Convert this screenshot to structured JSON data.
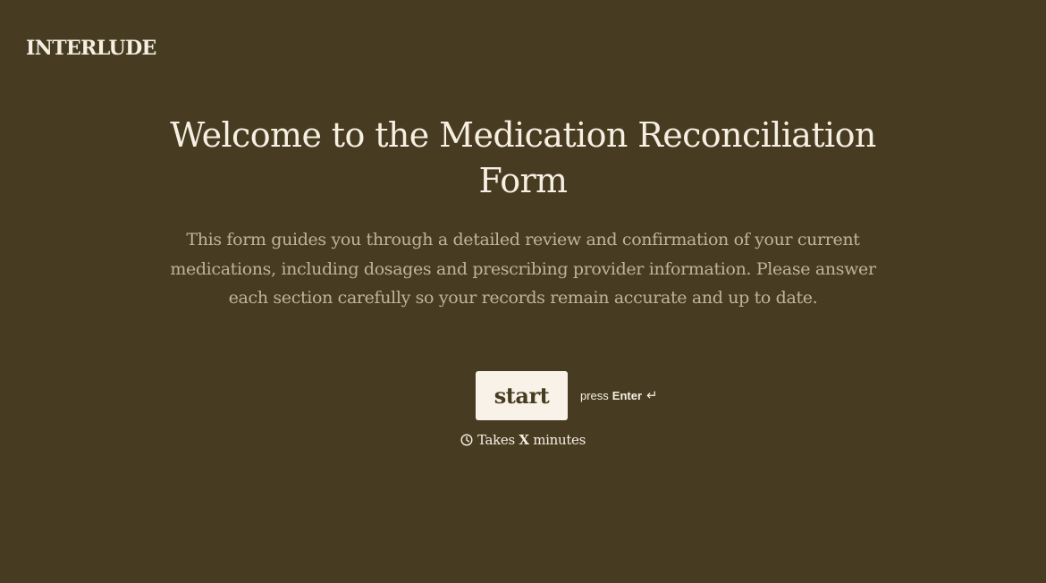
{
  "brand": {
    "logo_text": "INTERLUDE"
  },
  "welcome": {
    "title": "Welcome to the Medication Reconciliation Form",
    "description": "This form guides you through a detailed review and confirmation of your current medications, including dosages and prescribing provider information. Please answer each section carefully so your records remain accurate and up to date."
  },
  "actions": {
    "start_label": "start",
    "hint_prefix": "press",
    "hint_key": "Enter",
    "hint_icon": "↵"
  },
  "duration": {
    "icon": "clock-icon",
    "prefix": "Takes",
    "value": "X",
    "suffix": "minutes"
  },
  "colors": {
    "background": "#473c22",
    "text": "#f6efe2",
    "muted_text": "#bfb39a",
    "button_background": "#f8f2e8"
  }
}
